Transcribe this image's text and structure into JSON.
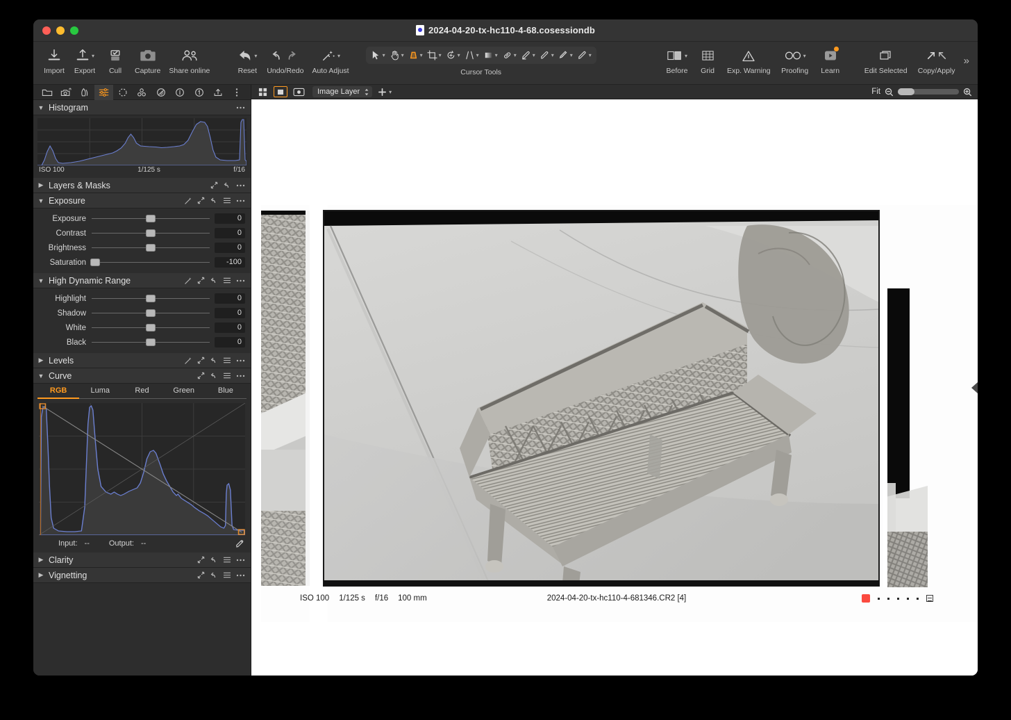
{
  "window": {
    "title": "2024-04-20-tx-hc110-4-68.cosessiondb",
    "doc_icon": "document-icon",
    "traffic_lights": [
      "close",
      "minimize",
      "maximize"
    ]
  },
  "toolbar": {
    "left_items": [
      {
        "label": "Import",
        "icon": "import-icon",
        "chevron": false
      },
      {
        "label": "Export",
        "icon": "export-icon",
        "chevron": true
      },
      {
        "label": "Cull",
        "icon": "cull-icon",
        "chevron": false
      },
      {
        "label": "Capture",
        "icon": "camera-icon",
        "chevron": false
      },
      {
        "label": "Share online",
        "icon": "share-people-icon",
        "chevron": false
      }
    ],
    "edit_items": [
      {
        "label": "Reset",
        "icon": "reset-icon",
        "chevron": true
      },
      {
        "label": "Undo/Redo",
        "icon": "undo-redo-icon",
        "chevron": false
      },
      {
        "label": "Auto Adjust",
        "icon": "auto-adjust-wand-icon",
        "chevron": true
      }
    ],
    "cursor_tools_label": "Cursor Tools",
    "cursor_tools": [
      {
        "name": "pointer-tool-icon",
        "active": false
      },
      {
        "name": "pan-hand-tool-icon",
        "active": false
      },
      {
        "name": "gradient-mask-tool-icon",
        "active": true
      },
      {
        "name": "crop-tool-icon",
        "active": false
      },
      {
        "name": "rotate-tool-icon",
        "active": false
      },
      {
        "name": "keystone-tool-icon",
        "active": false
      },
      {
        "name": "linear-gradient-tool-icon",
        "active": false
      },
      {
        "name": "spot-removal-tool-icon",
        "active": false
      },
      {
        "name": "heal-brush-tool-icon",
        "active": false
      },
      {
        "name": "clone-brush-tool-icon",
        "active": false
      },
      {
        "name": "erase-brush-tool-icon",
        "active": false
      },
      {
        "name": "draw-mask-tool-icon",
        "active": false
      }
    ],
    "right_items": [
      {
        "label": "Before",
        "icon": "before-after-icon",
        "chevron": true,
        "badge": false
      },
      {
        "label": "Grid",
        "icon": "grid-icon",
        "chevron": false,
        "badge": false
      },
      {
        "label": "Exp. Warning",
        "icon": "exposure-warning-icon",
        "chevron": false,
        "badge": false
      },
      {
        "label": "Proofing",
        "icon": "proofing-glasses-icon",
        "chevron": true,
        "badge": false
      },
      {
        "label": "Learn",
        "icon": "learn-play-icon",
        "chevron": false,
        "badge": true
      },
      {
        "label": "Edit Selected",
        "icon": "edit-selected-icon",
        "chevron": false,
        "badge": false
      },
      {
        "label": "Copy/Apply",
        "icon": "copy-apply-icon",
        "chevron": false,
        "badge": false
      }
    ],
    "overflow": "»"
  },
  "left_panel": {
    "tool_tabs": [
      {
        "name": "library-folder-tab",
        "active": false
      },
      {
        "name": "capture-camera-tab",
        "active": false
      },
      {
        "name": "lens-correction-tab",
        "active": false
      },
      {
        "name": "adjustments-sliders-tab",
        "active": true
      },
      {
        "name": "details-tab",
        "active": false
      },
      {
        "name": "styles-tab",
        "active": false
      },
      {
        "name": "color-editor-tab",
        "active": false
      },
      {
        "name": "metadata-info-tab",
        "active": false
      },
      {
        "name": "adjustments-clipboard-tab",
        "active": false
      },
      {
        "name": "output-export-tab",
        "active": false
      }
    ],
    "tool_tabs_overflow": "more-options-icon",
    "sections": {
      "histogram": {
        "title": "Histogram",
        "expanded": true,
        "labels": {
          "left": "ISO 100",
          "center": "1/125 s",
          "right": "f/16"
        }
      },
      "layers_masks": {
        "title": "Layers & Masks",
        "expanded": false
      },
      "exposure": {
        "title": "Exposure",
        "expanded": true,
        "sliders": [
          {
            "label": "Exposure",
            "value": "0",
            "pos": 50
          },
          {
            "label": "Contrast",
            "value": "0",
            "pos": 50
          },
          {
            "label": "Brightness",
            "value": "0",
            "pos": 50
          },
          {
            "label": "Saturation",
            "value": "-100",
            "pos": 2
          }
        ]
      },
      "hdr": {
        "title": "High Dynamic Range",
        "expanded": true,
        "sliders": [
          {
            "label": "Highlight",
            "value": "0",
            "pos": 50
          },
          {
            "label": "Shadow",
            "value": "0",
            "pos": 50
          },
          {
            "label": "White",
            "value": "0",
            "pos": 50
          },
          {
            "label": "Black",
            "value": "0",
            "pos": 50
          }
        ]
      },
      "levels": {
        "title": "Levels",
        "expanded": false
      },
      "curve": {
        "title": "Curve",
        "expanded": true,
        "tabs": [
          {
            "label": "RGB",
            "active": true
          },
          {
            "label": "Luma",
            "active": false
          },
          {
            "label": "Red",
            "active": false
          },
          {
            "label": "Green",
            "active": false
          },
          {
            "label": "Blue",
            "active": false
          }
        ],
        "input_label": "Input:",
        "input_value": "--",
        "output_label": "Output:",
        "output_value": "--",
        "picker_icon": "eyedropper-icon"
      },
      "clarity": {
        "title": "Clarity",
        "expanded": false
      },
      "vignetting": {
        "title": "Vignetting",
        "expanded": false
      }
    }
  },
  "viewer": {
    "toolbar": {
      "browser_grid_icon": "thumbnail-grid-icon",
      "viewer_icon": "single-viewer-icon",
      "preview_icon": "preview-eye-icon",
      "layer_select_value": "Image Layer",
      "add_layer_icon": "plus-icon",
      "zoom_label": "Fit",
      "zoom_out_icon": "zoom-out-icon",
      "zoom_in_icon": "zoom-in-icon"
    },
    "image_meta": {
      "iso": "ISO 100",
      "shutter": "1/125 s",
      "aperture": "f/16",
      "focal": "100 mm",
      "filename": "2024-04-20-tx-hc110-4-681346.CR2 [4]",
      "color_label": "#fb4a3f",
      "rating_dots": 5,
      "grid_icon": "filmstrip-icon"
    }
  },
  "colors": {
    "accent": "#ff9a1f",
    "panel_bg": "#2d2d2d",
    "toolbar_bg": "#323232",
    "titlebar_bg": "#343434",
    "canvas_bg": "#ffffff"
  }
}
